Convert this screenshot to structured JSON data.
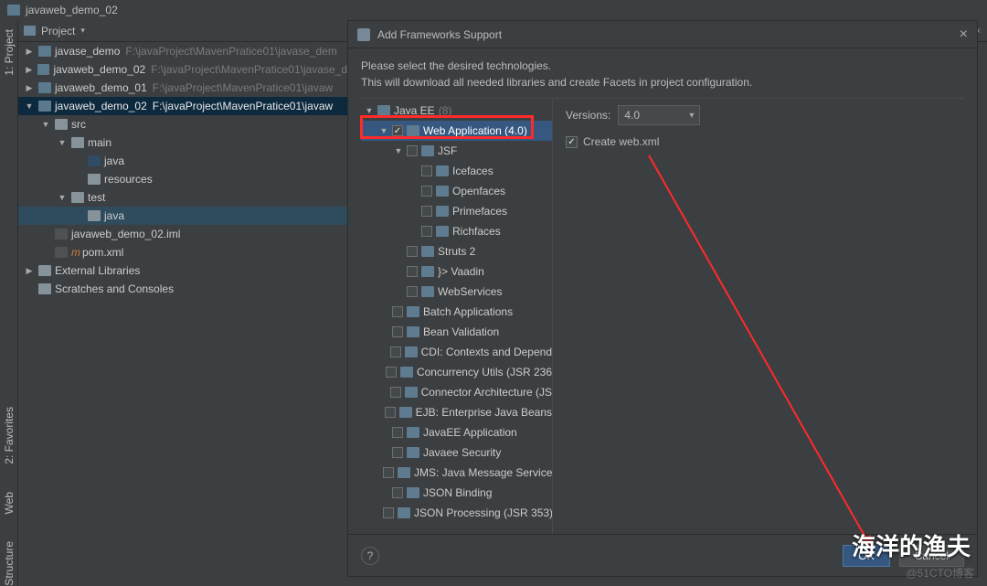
{
  "window": {
    "title": "javaweb_demo_02"
  },
  "toolbar": {
    "label": "Project"
  },
  "leftgutter": [
    {
      "label": "1: Project"
    },
    {
      "label": "2: Favorites"
    },
    {
      "label": "Web"
    },
    {
      "label": "Structure"
    }
  ],
  "tree": [
    {
      "indent": 0,
      "arrow": "▶",
      "ico": "folder",
      "name": "javase_demo",
      "path": "F:\\javaProject\\MavenPratice01\\javase_dem"
    },
    {
      "indent": 0,
      "arrow": "▶",
      "ico": "folder",
      "name": "javaweb_demo_02",
      "path": "F:\\javaProject\\MavenPratice01\\javase_d"
    },
    {
      "indent": 0,
      "arrow": "▶",
      "ico": "folder",
      "name": "javaweb_demo_01",
      "path": "F:\\javaProject\\MavenPratice01\\javaw"
    },
    {
      "indent": 0,
      "arrow": "▼",
      "ico": "folder",
      "name": "javaweb_demo_02",
      "path": "F:\\javaProject\\MavenPratice01\\javaw",
      "selected": true
    },
    {
      "indent": 1,
      "arrow": "▼",
      "ico": "folder2",
      "name": "src"
    },
    {
      "indent": 2,
      "arrow": "▼",
      "ico": "folder2",
      "name": "main"
    },
    {
      "indent": 3,
      "arrow": "",
      "ico": "navy",
      "name": "java"
    },
    {
      "indent": 3,
      "arrow": "",
      "ico": "folder2",
      "name": "resources"
    },
    {
      "indent": 2,
      "arrow": "▼",
      "ico": "folder2",
      "name": "test"
    },
    {
      "indent": 3,
      "arrow": "",
      "ico": "folder2",
      "name": "java",
      "row_sel": true
    },
    {
      "indent": 1,
      "arrow": "",
      "ico": "file",
      "name": "javaweb_demo_02.iml"
    },
    {
      "indent": 1,
      "arrow": "",
      "ico": "file",
      "name": "pom.xml",
      "prefix": "m"
    },
    {
      "indent": 0,
      "arrow": "▶",
      "ico": "folder2",
      "name": "External Libraries",
      "prefixIcon": "lib"
    },
    {
      "indent": 0,
      "arrow": "",
      "ico": "folder2",
      "name": "Scratches and Consoles"
    }
  ],
  "dialog": {
    "title": "Add Frameworks Support",
    "desc1": "Please select the desired technologies.",
    "desc2": "This will download all needed libraries and create Facets in project configuration.",
    "versions_label": "Versions:",
    "versions_value": "4.0",
    "create_webxml": "Create web.xml",
    "ok": "OK",
    "cancel": "Cancel"
  },
  "frameworks": [
    {
      "indent": 0,
      "arrow": "▼",
      "cb": false,
      "label": "Java EE",
      "dim": "(8)",
      "header": true
    },
    {
      "indent": 1,
      "arrow": "▼",
      "cb": true,
      "label": "Web Application (4.0)",
      "selected": true
    },
    {
      "indent": 2,
      "arrow": "▼",
      "cb": false,
      "label": "JSF"
    },
    {
      "indent": 3,
      "arrow": "",
      "cb": false,
      "label": "Icefaces"
    },
    {
      "indent": 3,
      "arrow": "",
      "cb": false,
      "label": "Openfaces"
    },
    {
      "indent": 3,
      "arrow": "",
      "cb": false,
      "label": "Primefaces"
    },
    {
      "indent": 3,
      "arrow": "",
      "cb": false,
      "label": "Richfaces"
    },
    {
      "indent": 2,
      "arrow": "",
      "cb": false,
      "label": "Struts 2"
    },
    {
      "indent": 2,
      "arrow": "",
      "cb": false,
      "label": "}> Vaadin",
      "raw": true
    },
    {
      "indent": 2,
      "arrow": "",
      "cb": false,
      "label": "WebServices"
    },
    {
      "indent": 1,
      "arrow": "",
      "cb": false,
      "label": "Batch Applications"
    },
    {
      "indent": 1,
      "arrow": "",
      "cb": false,
      "label": "Bean Validation"
    },
    {
      "indent": 1,
      "arrow": "",
      "cb": false,
      "label": "CDI: Contexts and Depend"
    },
    {
      "indent": 1,
      "arrow": "",
      "cb": false,
      "label": "Concurrency Utils (JSR 236"
    },
    {
      "indent": 1,
      "arrow": "",
      "cb": false,
      "label": "Connector Architecture (JS"
    },
    {
      "indent": 1,
      "arrow": "",
      "cb": false,
      "label": "EJB: Enterprise Java Beans"
    },
    {
      "indent": 1,
      "arrow": "",
      "cb": false,
      "label": "JavaEE Application"
    },
    {
      "indent": 1,
      "arrow": "",
      "cb": false,
      "label": "Javaee Security"
    },
    {
      "indent": 1,
      "arrow": "",
      "cb": false,
      "label": "JMS: Java Message Service"
    },
    {
      "indent": 1,
      "arrow": "",
      "cb": false,
      "label": "JSON Binding"
    },
    {
      "indent": 1,
      "arrow": "",
      "cb": false,
      "label": "JSON Processing (JSR 353)"
    }
  ],
  "watermark": {
    "main": "海洋的渔夫",
    "sub": "@51CTO博客"
  }
}
